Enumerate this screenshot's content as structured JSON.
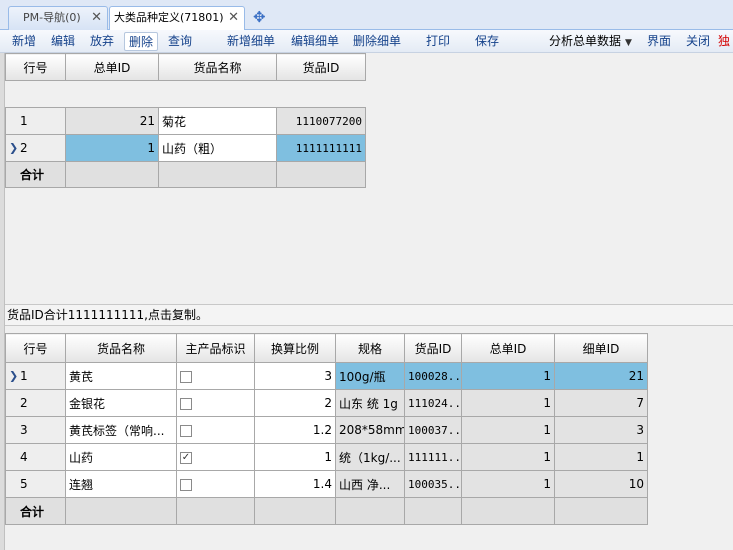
{
  "tabs": [
    {
      "label": "PM-导航(0)",
      "active": false
    },
    {
      "label": "大类品种定义(71801)",
      "active": true
    }
  ],
  "toolbar": {
    "add": "新增",
    "edit": "编辑",
    "discard": "放弃",
    "delete": "删除",
    "query": "查询",
    "add_detail": "新增细单",
    "edit_detail": "编辑细单",
    "delete_detail": "删除细单",
    "print": "打印",
    "save": "保存",
    "analyze": "分析总单数据",
    "layout": "界面",
    "close": "关闭",
    "standalone": "独"
  },
  "master": {
    "columns": [
      "行号",
      "总单ID",
      "货品名称",
      "货品ID"
    ],
    "rows": [
      {
        "row": "1",
        "master_id": "21",
        "name": "菊花",
        "goods_id": "1110077200"
      },
      {
        "row": "2",
        "master_id": "1",
        "name": "山药（粗）",
        "goods_id": "1111111111"
      }
    ],
    "total_label": "合计"
  },
  "status_text": "货品ID合计1111111111,点击复制。",
  "detail": {
    "columns": [
      "行号",
      "货品名称",
      "主产品标识",
      "换算比例",
      "规格",
      "货品ID",
      "总单ID",
      "细单ID"
    ],
    "rows": [
      {
        "row": "1",
        "name": "黄芪",
        "main": false,
        "ratio": "3",
        "spec": "100g/瓶",
        "goods_id": "100028...",
        "master_id": "1",
        "detail_id": "21"
      },
      {
        "row": "2",
        "name": "金银花",
        "main": false,
        "ratio": "2",
        "spec": "山东 统 1g",
        "goods_id": "111024...",
        "master_id": "1",
        "detail_id": "7"
      },
      {
        "row": "3",
        "name": "黄芪标签（常响...",
        "main": false,
        "ratio": "1.2",
        "spec": "208*58mm",
        "goods_id": "100037...",
        "master_id": "1",
        "detail_id": "3"
      },
      {
        "row": "4",
        "name": "山药",
        "main": true,
        "ratio": "1",
        "spec": "统（1kg/...",
        "goods_id": "111111...",
        "master_id": "1",
        "detail_id": "1"
      },
      {
        "row": "5",
        "name": "连翘",
        "main": false,
        "ratio": "1.4",
        "spec": "山西 净...",
        "goods_id": "100035...",
        "master_id": "1",
        "detail_id": "10"
      }
    ],
    "total_label": "合计"
  },
  "icons": {
    "tab_close": "close-icon",
    "new_tab": "add-tab-icon",
    "current_row": "row-pointer-icon",
    "dropdown": "caret-down-icon",
    "checked_mark": "✓"
  }
}
